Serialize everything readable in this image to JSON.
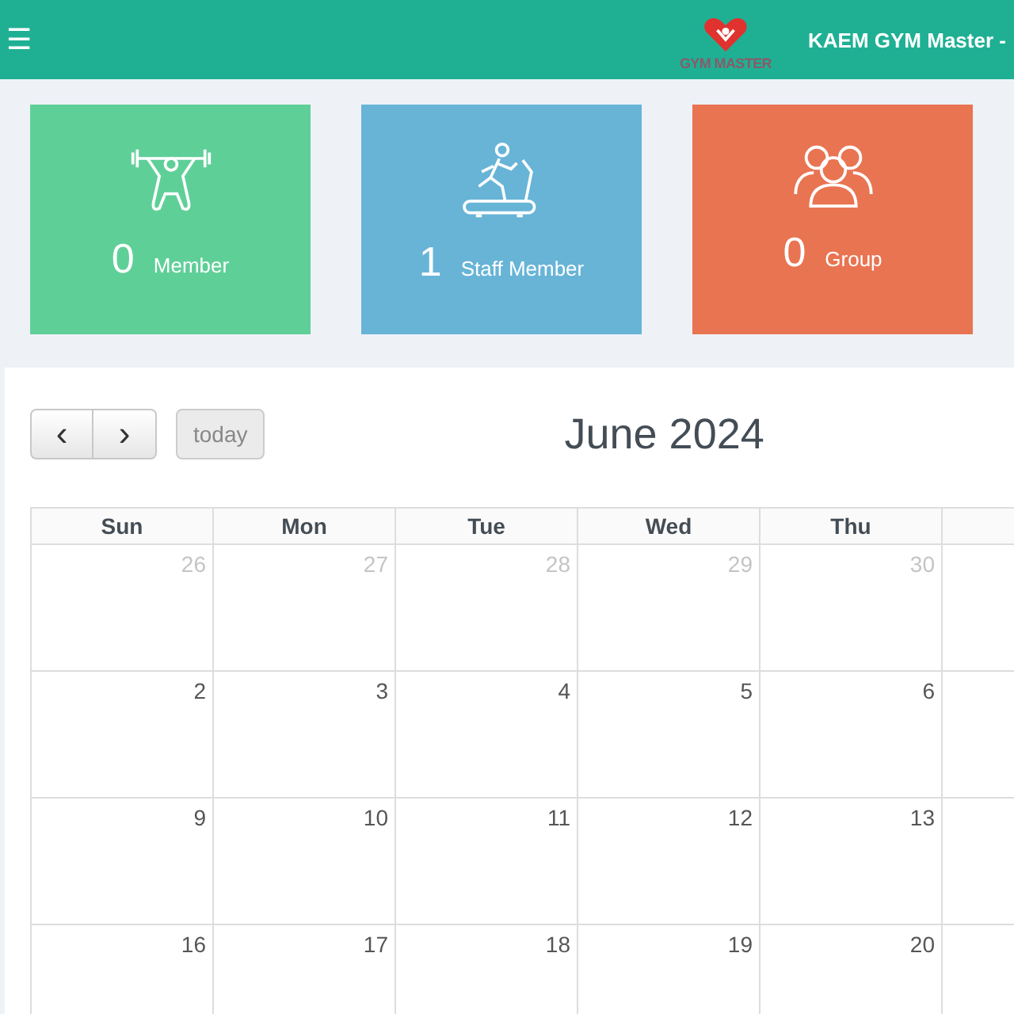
{
  "header": {
    "menu_icon": "☰",
    "logo_text": "GYM MASTER",
    "title": "KAEM GYM Master -"
  },
  "stat_cards": [
    {
      "kind": "weights",
      "count": "0",
      "label": "Member",
      "color": "#5fcf98"
    },
    {
      "kind": "treadmill",
      "count": "1",
      "label": "Staff Member",
      "color": "#67b4d7"
    },
    {
      "kind": "group",
      "count": "0",
      "label": "Group",
      "color": "#e97452"
    }
  ],
  "calendar": {
    "prev_button": "‹",
    "next_button": "›",
    "today_button": "today",
    "today_disabled": true,
    "title": "June 2024",
    "day_headers": [
      "Sun",
      "Mon",
      "Tue",
      "Wed",
      "Thu"
    ],
    "weeks": [
      {
        "days": [
          {
            "label": "26",
            "other_month": true
          },
          {
            "label": "27",
            "other_month": true
          },
          {
            "label": "28",
            "other_month": true
          },
          {
            "label": "29",
            "other_month": true
          },
          {
            "label": "30",
            "other_month": true
          }
        ]
      },
      {
        "days": [
          {
            "label": "2",
            "other_month": false
          },
          {
            "label": "3",
            "other_month": false
          },
          {
            "label": "4",
            "other_month": false
          },
          {
            "label": "5",
            "other_month": false
          },
          {
            "label": "6",
            "other_month": false
          }
        ]
      },
      {
        "days": [
          {
            "label": "9",
            "other_month": false
          },
          {
            "label": "10",
            "other_month": false
          },
          {
            "label": "11",
            "other_month": false
          },
          {
            "label": "12",
            "other_month": false
          },
          {
            "label": "13",
            "other_month": false
          }
        ]
      },
      {
        "days": [
          {
            "label": "16",
            "other_month": false
          },
          {
            "label": "17",
            "other_month": false
          },
          {
            "label": "18",
            "other_month": false
          },
          {
            "label": "19",
            "other_month": false
          },
          {
            "label": "20",
            "other_month": false
          }
        ]
      }
    ]
  }
}
